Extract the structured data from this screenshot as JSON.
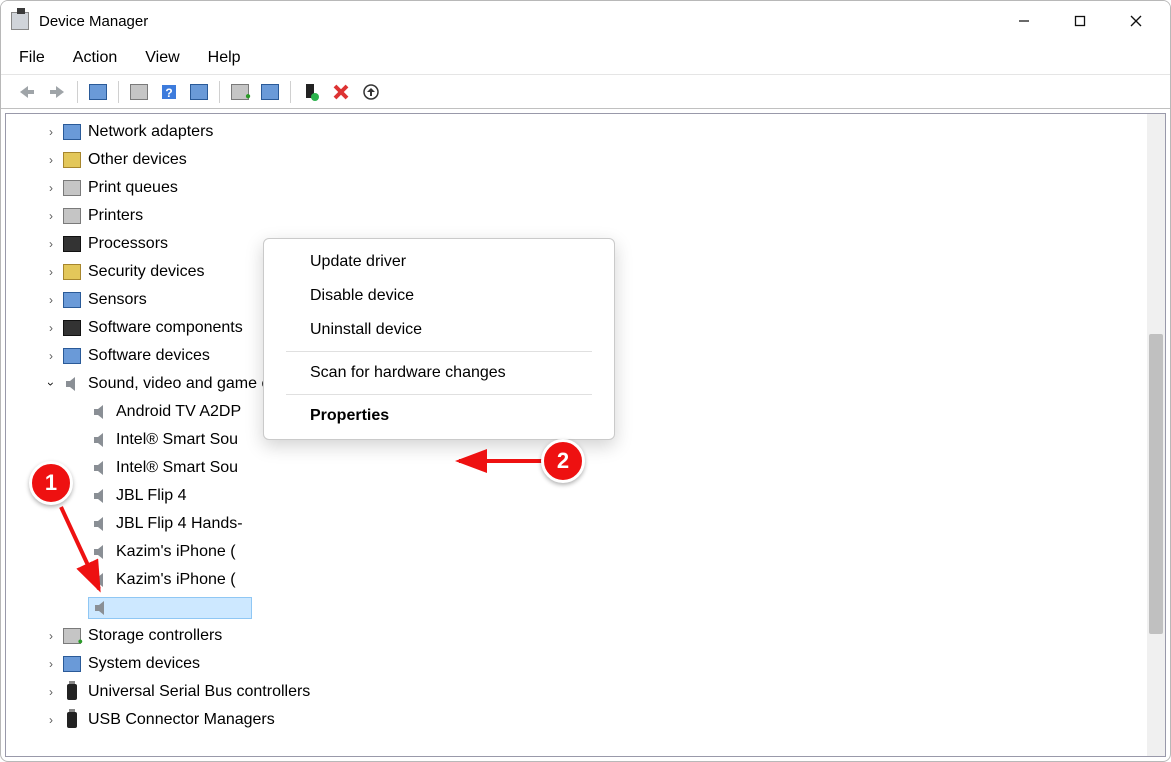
{
  "titlebar": {
    "title": "Device Manager"
  },
  "menubar": {
    "file": "File",
    "action": "Action",
    "view": "View",
    "help": "Help"
  },
  "tree": {
    "categories": [
      {
        "name": "Network adapters",
        "icon": "net"
      },
      {
        "name": "Other devices",
        "icon": "other"
      },
      {
        "name": "Print queues",
        "icon": "printq"
      },
      {
        "name": "Printers",
        "icon": "printer"
      },
      {
        "name": "Processors",
        "icon": "cpu"
      },
      {
        "name": "Security devices",
        "icon": "security"
      },
      {
        "name": "Sensors",
        "icon": "sensor"
      },
      {
        "name": "Software components",
        "icon": "swc"
      },
      {
        "name": "Software devices",
        "icon": "swd"
      }
    ],
    "expanded": {
      "name": "Sound, video and game controllers",
      "children": [
        "Android TV A2DP",
        "Intel® Smart Sou",
        "Intel® Smart Sou",
        "JBL Flip 4",
        "JBL Flip 4 Hands-",
        "Kazim's iPhone (",
        "Kazim's iPhone ("
      ]
    },
    "after": [
      {
        "name": "Storage controllers",
        "icon": "storage"
      },
      {
        "name": "System devices",
        "icon": "system"
      },
      {
        "name": "Universal Serial Bus controllers",
        "icon": "usb"
      },
      {
        "name": "USB Connector Managers",
        "icon": "usb"
      }
    ]
  },
  "context_menu": {
    "update": "Update driver",
    "disable": "Disable device",
    "uninstall": "Uninstall device",
    "scan": "Scan for hardware changes",
    "properties": "Properties"
  },
  "annotations": {
    "step1": "1",
    "step2": "2"
  }
}
